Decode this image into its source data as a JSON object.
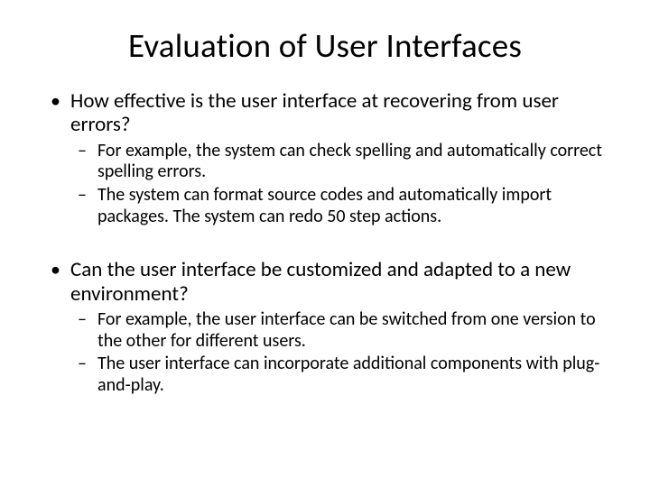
{
  "title": "Evaluation of User Interfaces",
  "bullets": [
    {
      "text": "How effective is the user interface at recovering from user errors?",
      "sub": [
        "For example, the system can check spelling and automatically correct spelling errors.",
        "The system can format source codes and automatically import packages. The system can redo 50 step actions."
      ]
    },
    {
      "text": "Can the user interface be customized and adapted to a new environment?",
      "sub": [
        "For example, the user interface can be switched from one version to the other for different users.",
        "The user interface can incorporate additional components with plug-and-play."
      ]
    }
  ]
}
